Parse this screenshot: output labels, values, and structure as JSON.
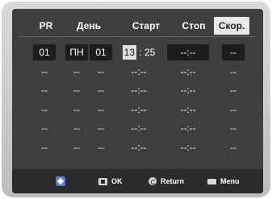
{
  "header": {
    "columns": [
      "PR",
      "День",
      "Старт",
      "Стоп",
      "Скор."
    ],
    "active_index": 4
  },
  "rows": [
    [
      "01",
      "ПН",
      "01",
      "13 : 25",
      "--:--",
      "--"
    ],
    [
      "--",
      "--",
      "--",
      "--:--",
      "--:--",
      "--"
    ],
    [
      "--",
      "--",
      "--",
      "--:--",
      "--:--",
      "--"
    ],
    [
      "--",
      "--",
      "--",
      "--:--",
      "--:--",
      "--"
    ],
    [
      "--",
      "--",
      "--",
      "--:--",
      "--:--",
      "--"
    ],
    [
      "--",
      "--",
      "--",
      "--:--",
      "--:--",
      "--"
    ]
  ],
  "editing": {
    "row": 0,
    "highlight_text": "13"
  },
  "footer": {
    "ok_label": "OK",
    "return_label": "Return",
    "menu_label": "Menu"
  },
  "icons": {
    "nav": "navigation-arrows-icon",
    "ok": "ok-button-icon",
    "return": "return-icon",
    "menu": "menu-icon"
  },
  "colors": {
    "screen_bg": "#3f3f3f",
    "frame": "#c8c8c8",
    "highlight": "#e0e0e0",
    "text": "#ffffff"
  }
}
